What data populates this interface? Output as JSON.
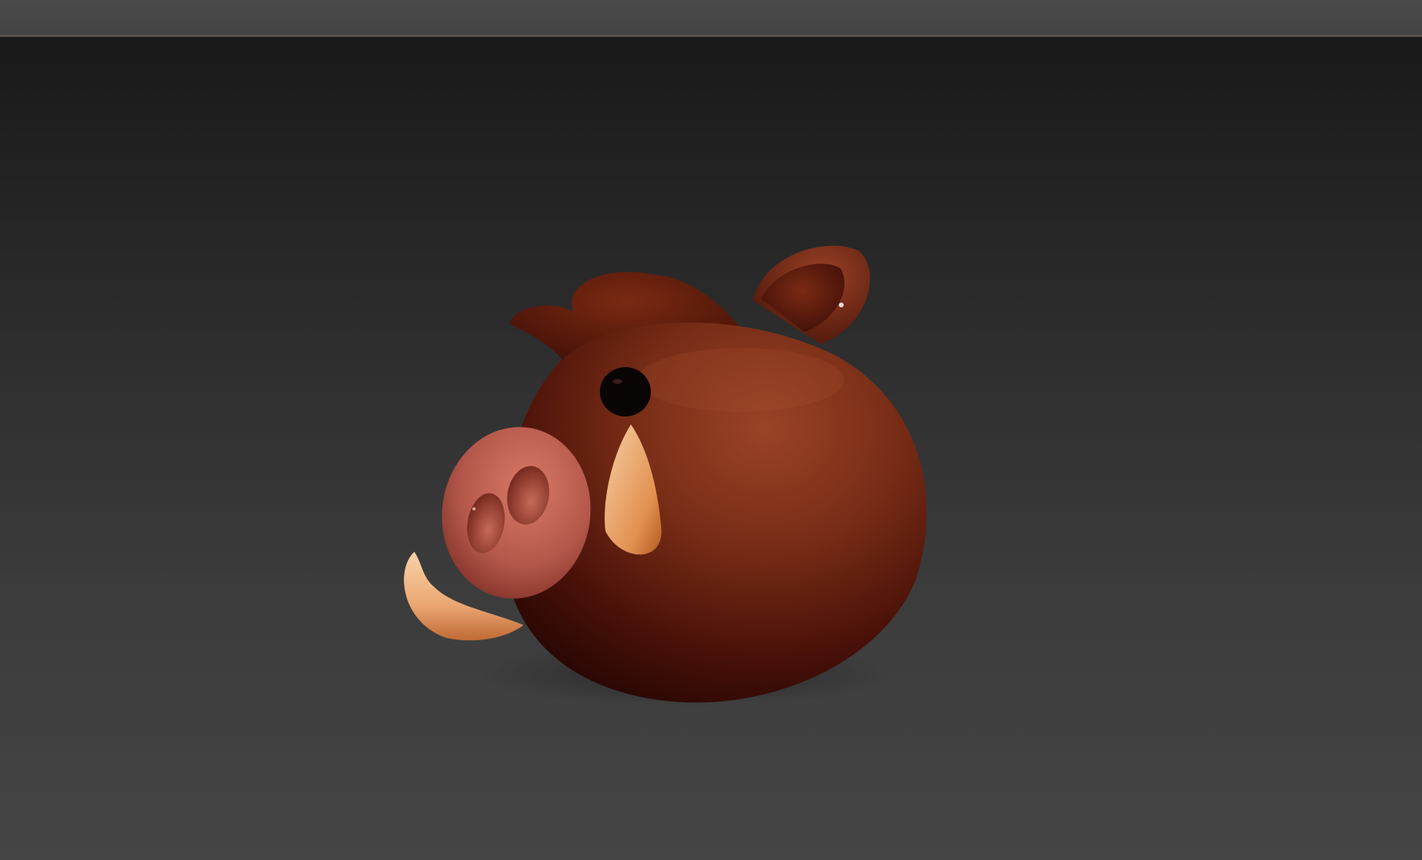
{
  "app": {
    "colors": {
      "toolbar_bg": "#474747",
      "toolbar_border": "#5e5a4e",
      "viewport_top": "#191919",
      "viewport_bottom": "#454545"
    }
  },
  "viewport": {
    "object": {
      "icon": "boar-head-3d-model",
      "colors": {
        "skin": "#7a2d16",
        "skin_dark": "#2a0704",
        "mane": "#5e1e0c",
        "snout": "#c8695a",
        "tusk": "#f0b07a",
        "eye": "#0a0505"
      }
    }
  }
}
